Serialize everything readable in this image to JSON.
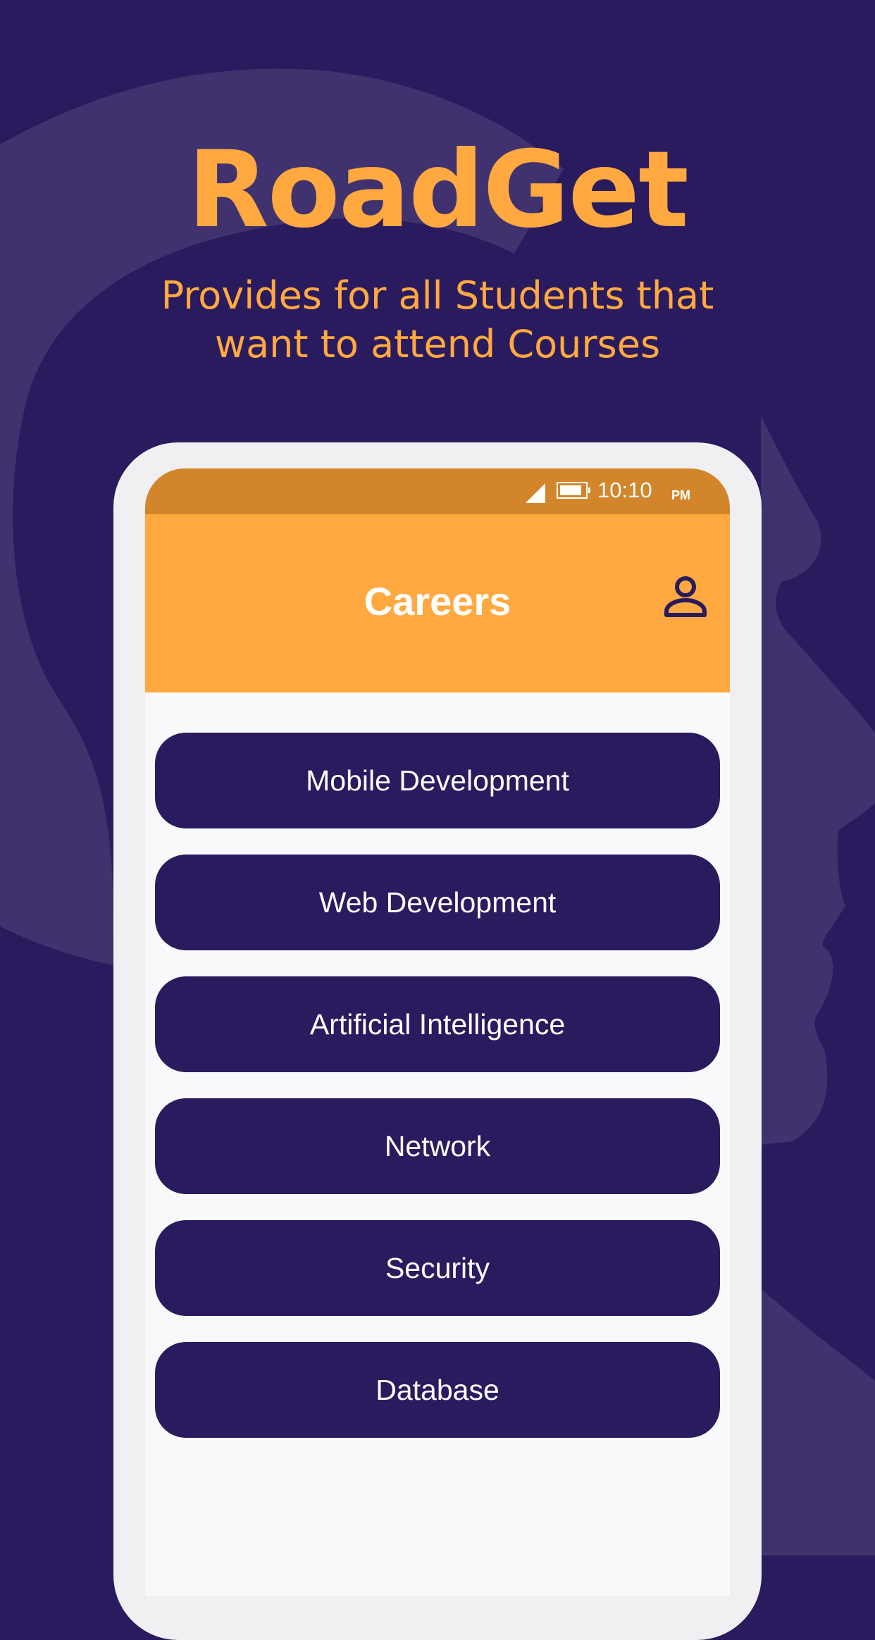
{
  "splash": {
    "title": "RoadGet",
    "tagline_line1": "Provides for all Students that",
    "tagline_line2": "want to attend Courses"
  },
  "status_bar": {
    "time": "10:10",
    "ampm": "PM",
    "icons": [
      "signal-icon",
      "battery-icon"
    ]
  },
  "app_bar": {
    "title": "Careers",
    "action_icon": "person-icon"
  },
  "careers": [
    {
      "label": "Mobile Development"
    },
    {
      "label": "Web Development"
    },
    {
      "label": "Artificial Intelligence"
    },
    {
      "label": "Network"
    },
    {
      "label": "Security"
    },
    {
      "label": "Database"
    }
  ],
  "colors": {
    "background": "#2a1b5e",
    "background_shape": "#40326e",
    "accent": "#ffa940",
    "status_bar": "#d2852b",
    "button": "#2a1b5e",
    "button_text": "#ffffff",
    "screen": "#f8f9fb",
    "phone_frame": "#f0f0f2"
  }
}
